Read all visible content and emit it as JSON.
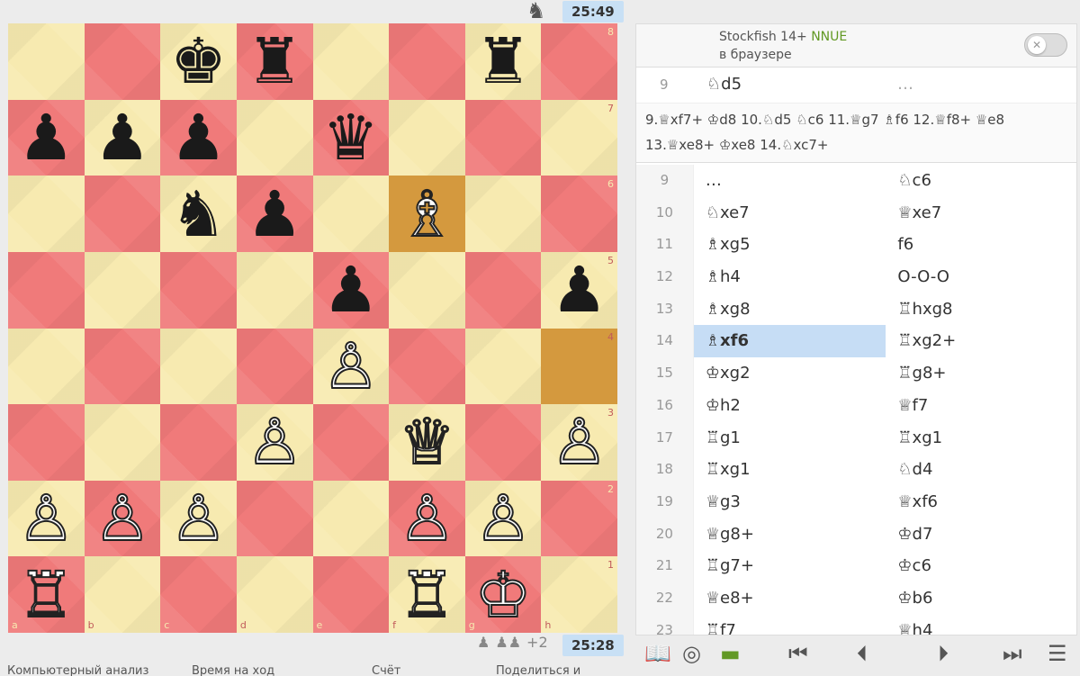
{
  "board": {
    "files": [
      "a",
      "b",
      "c",
      "d",
      "e",
      "f",
      "g",
      "h"
    ],
    "ranks": [
      "8",
      "7",
      "6",
      "5",
      "4",
      "3",
      "2",
      "1"
    ],
    "highlight": [
      "f6",
      "h4"
    ],
    "pieces": {
      "c8": {
        "glyph": "♚",
        "color": "b"
      },
      "d8": {
        "glyph": "♜",
        "color": "b"
      },
      "g8": {
        "glyph": "♜",
        "color": "b"
      },
      "a7": {
        "glyph": "♟",
        "color": "b"
      },
      "b7": {
        "glyph": "♟",
        "color": "b"
      },
      "c7": {
        "glyph": "♟",
        "color": "b"
      },
      "e7": {
        "glyph": "♛",
        "color": "b"
      },
      "c6": {
        "glyph": "♞",
        "color": "b"
      },
      "d6": {
        "glyph": "♟",
        "color": "b"
      },
      "f6": {
        "glyph": "♗",
        "color": "w"
      },
      "e5": {
        "glyph": "♟",
        "color": "b"
      },
      "h5": {
        "glyph": "♟",
        "color": "b"
      },
      "e4": {
        "glyph": "♙",
        "color": "w"
      },
      "d3": {
        "glyph": "♙",
        "color": "w"
      },
      "f3": {
        "glyph": "♕",
        "color": "w"
      },
      "h3": {
        "glyph": "♙",
        "color": "w"
      },
      "a2": {
        "glyph": "♙",
        "color": "w"
      },
      "b2": {
        "glyph": "♙",
        "color": "w"
      },
      "c2": {
        "glyph": "♙",
        "color": "w"
      },
      "f2": {
        "glyph": "♙",
        "color": "w"
      },
      "g2": {
        "glyph": "♙",
        "color": "w"
      },
      "a1": {
        "glyph": "♖",
        "color": "w"
      },
      "f1": {
        "glyph": "♖",
        "color": "w"
      },
      "g1": {
        "glyph": "♔",
        "color": "w"
      }
    }
  },
  "clocks": {
    "top": "25:49",
    "bottom": "25:28"
  },
  "spectators": {
    "extra": "+2"
  },
  "bottom_tabs": [
    "Компьютерный анализ",
    "Время на ход",
    "Счёт",
    "Поделиться и"
  ],
  "engine": {
    "name": "Stockfish 14+",
    "nnue": "NNUE",
    "sub": "в браузере"
  },
  "pv": {
    "num": "9",
    "move": "♘d5",
    "dots": "…",
    "line": "9.♕xf7+ ♔d8 10.♘d5 ♘c6 11.♕g7 ♗f6 12.♕f8+ ♕e8 13.♕xe8+ ♔xe8 14.♘xc7+"
  },
  "moves": [
    {
      "n": "9",
      "w": "…",
      "b": "♘c6"
    },
    {
      "n": "10",
      "w": "♘xe7",
      "b": "♕xe7"
    },
    {
      "n": "11",
      "w": "♗xg5",
      "b": "f6"
    },
    {
      "n": "12",
      "w": "♗h4",
      "b": "O-O-O"
    },
    {
      "n": "13",
      "w": "♗xg8",
      "b": "♖hxg8"
    },
    {
      "n": "14",
      "w": "♗xf6",
      "b": "♖xg2+",
      "active": true
    },
    {
      "n": "15",
      "w": "♔xg2",
      "b": "♖g8+"
    },
    {
      "n": "16",
      "w": "♔h2",
      "b": "♕f7"
    },
    {
      "n": "17",
      "w": "♖g1",
      "b": "♖xg1"
    },
    {
      "n": "18",
      "w": "♖xg1",
      "b": "♘d4"
    },
    {
      "n": "19",
      "w": "♕g3",
      "b": "♕xf6"
    },
    {
      "n": "20",
      "w": "♕g8+",
      "b": "♔d7"
    },
    {
      "n": "21",
      "w": "♖g7+",
      "b": "♔c6"
    },
    {
      "n": "22",
      "w": "♕e8+",
      "b": "♔b6"
    },
    {
      "n": "23",
      "w": "♖f7",
      "b": "♕h4"
    }
  ]
}
